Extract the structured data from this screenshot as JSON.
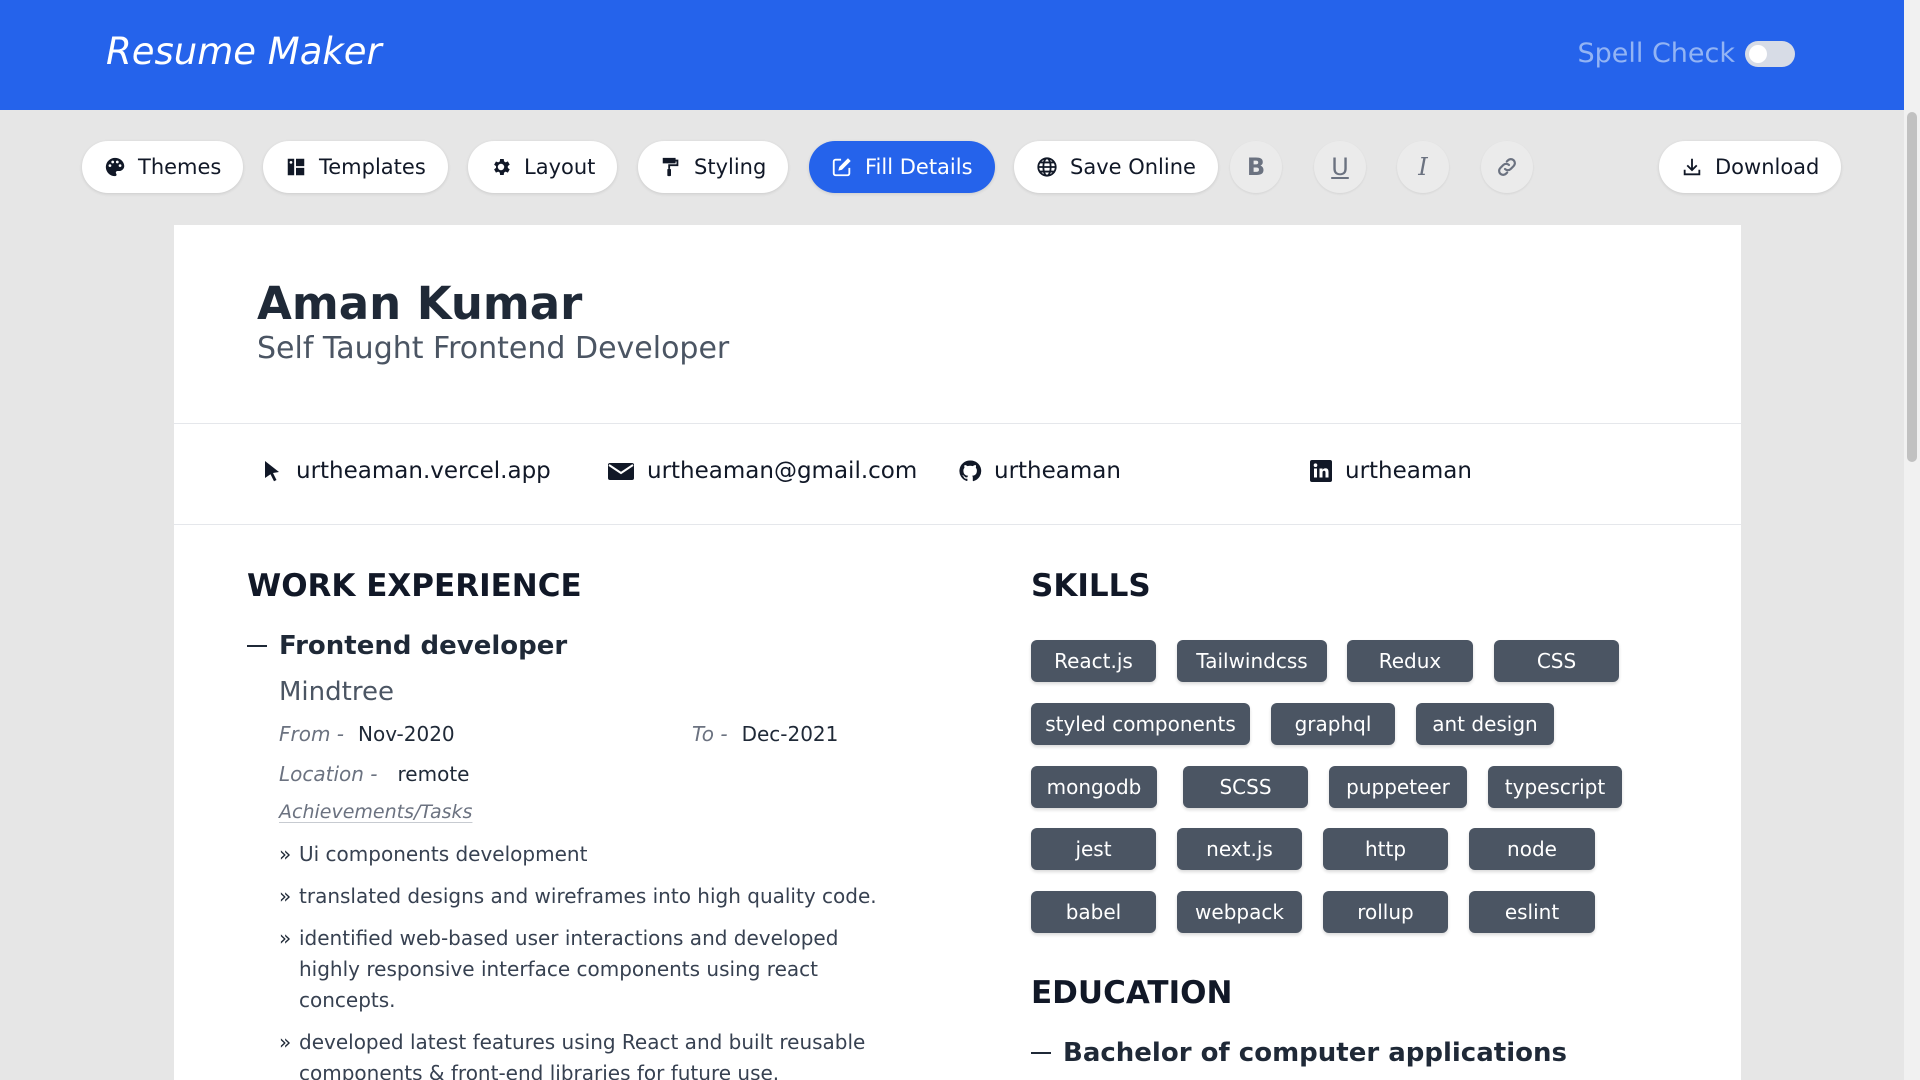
{
  "app": {
    "title": "Resume Maker",
    "spell_check_label": "Spell Check",
    "spell_check_on": false
  },
  "colors": {
    "header_bg": "#2563eb",
    "active_button": "#2563eb",
    "chip_bg": "#4b5563"
  },
  "toolbar": {
    "themes": "Themes",
    "templates": "Templates",
    "layout": "Layout",
    "styling": "Styling",
    "fill_details": "Fill Details",
    "save_online": "Save Online",
    "bold": "B",
    "underline": "U",
    "italic": "I",
    "download": "Download",
    "active": "Fill Details"
  },
  "resume": {
    "name": "Aman Kumar",
    "title": "Self Taught Frontend Developer",
    "contacts": {
      "website": "urtheaman.vercel.app",
      "email": "urtheaman@gmail.com",
      "github": "urtheaman",
      "linkedin": "urtheaman"
    },
    "work": {
      "heading": "WORK EXPERIENCE",
      "role": "Frontend developer",
      "company": "Mindtree",
      "from_label": "From -",
      "from": "Nov-2020",
      "to_label": "To -",
      "to": "Dec-2021",
      "location_label": "Location -",
      "location": "remote",
      "achievements_label": "Achievements/Tasks",
      "bullet_mark": "»",
      "achievements": [
        "Ui components development",
        "translated designs and wireframes into high quality code.",
        "identified web-based user interactions and developed highly responsive interface components using react concepts.",
        "developed latest features using React and built reusable components & front-end libraries for future use."
      ]
    },
    "skills": {
      "heading": "SKILLS",
      "items": [
        "React.js",
        "Tailwindcss",
        "Redux",
        "CSS",
        "styled components",
        "graphql",
        "ant design",
        "mongodb",
        "SCSS",
        "puppeteer",
        "typescript",
        "jest",
        "next.js",
        "http",
        "node",
        "babel",
        "webpack",
        "rollup",
        "eslint"
      ]
    },
    "education": {
      "heading": "EDUCATION",
      "degree": "Bachelor of computer applications"
    }
  }
}
